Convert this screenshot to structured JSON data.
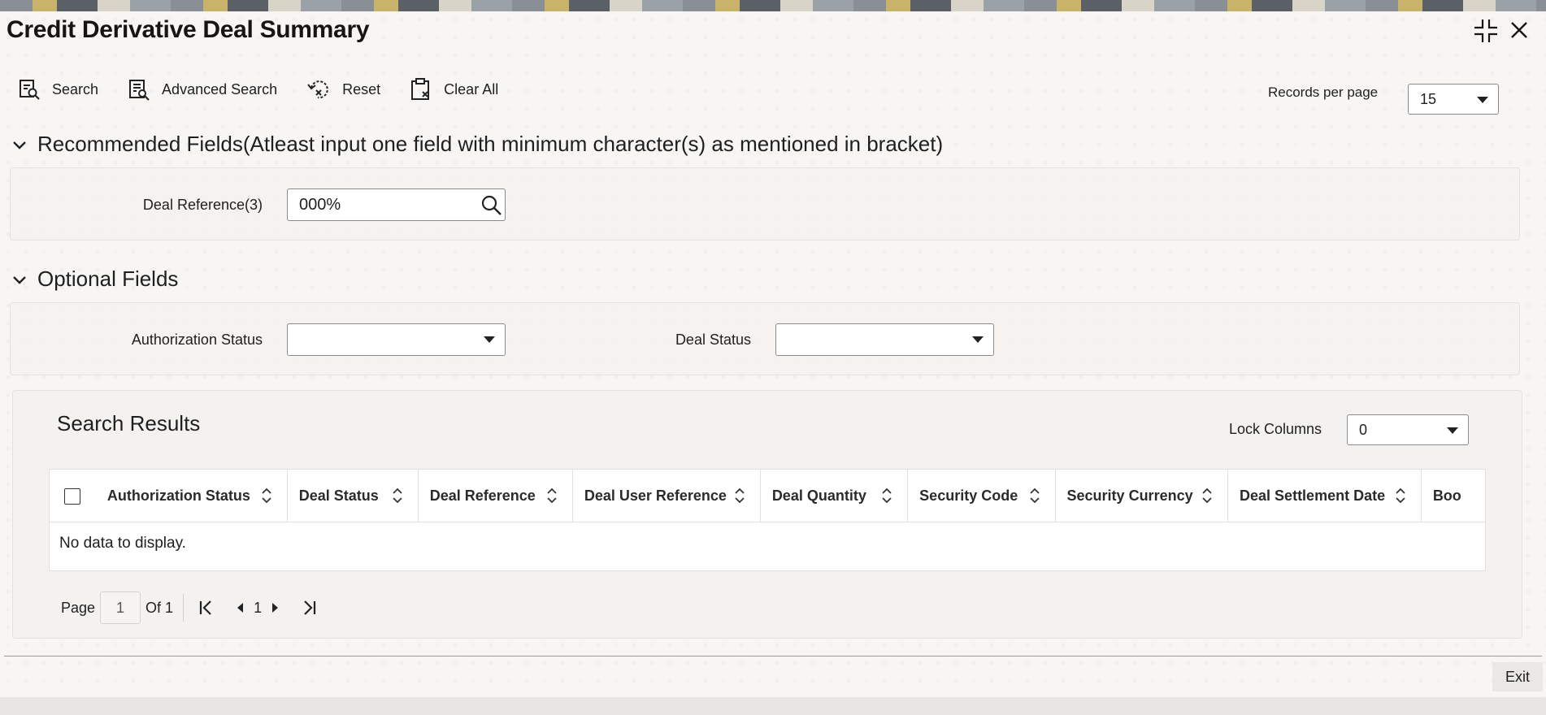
{
  "window": {
    "title": "Credit Derivative Deal Summary",
    "maximize_icon": "maximize-icon",
    "close_icon": "close-icon"
  },
  "toolbar": {
    "search_label": "Search",
    "advanced_search_label": "Advanced Search",
    "reset_label": "Reset",
    "clear_all_label": "Clear All",
    "records_per_page_label": "Records per page",
    "records_per_page_value": "15"
  },
  "recommended": {
    "heading": "Recommended Fields(Atleast input one field with minimum character(s) as mentioned in bracket)",
    "deal_reference_label": "Deal Reference(3)",
    "deal_reference_value": "000%"
  },
  "optional": {
    "heading": "Optional Fields",
    "authorization_status_label": "Authorization Status",
    "authorization_status_value": "",
    "deal_status_label": "Deal Status",
    "deal_status_value": ""
  },
  "results": {
    "title": "Search Results",
    "lock_columns_label": "Lock Columns",
    "lock_columns_value": "0",
    "columns": [
      "Authorization Status",
      "Deal Status",
      "Deal Reference",
      "Deal User Reference",
      "Deal Quantity",
      "Security Code",
      "Security Currency",
      "Deal Settlement Date",
      "Boo"
    ],
    "empty_message": "No data to display."
  },
  "pagination": {
    "page_label": "Page",
    "current_page": "1",
    "of_label": "Of 1",
    "page_number": "1"
  },
  "footer": {
    "exit_label": "Exit"
  }
}
